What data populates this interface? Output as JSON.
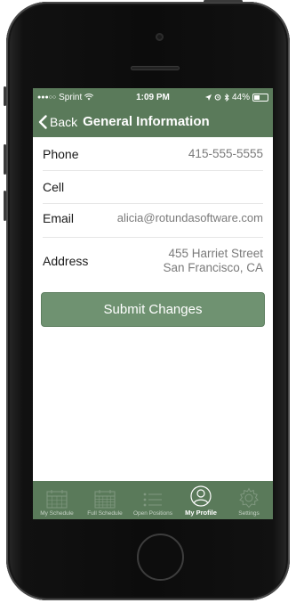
{
  "status_bar": {
    "carrier": "Sprint",
    "time": "1:09 PM",
    "battery_percent": "44%",
    "battery_level": 0.44
  },
  "nav": {
    "back_label": "Back",
    "title": "General Information"
  },
  "fields": [
    {
      "label": "Phone",
      "value": "415-555-5555"
    },
    {
      "label": "Cell",
      "value": ""
    },
    {
      "label": "Email",
      "value": "alicia@rotundasoftware.com"
    },
    {
      "label": "Address",
      "value": "455 Harriet Street San Francisco, CA"
    }
  ],
  "submit_label": "Submit Changes",
  "tabs": [
    {
      "label": "My Schedule",
      "icon": "calendar-icon",
      "active": false
    },
    {
      "label": "Full Schedule",
      "icon": "calendar-grid-icon",
      "active": false
    },
    {
      "label": "Open Positions",
      "icon": "list-icon",
      "active": false
    },
    {
      "label": "My Profile",
      "icon": "profile-icon",
      "active": true
    },
    {
      "label": "Settings",
      "icon": "gear-icon",
      "active": false
    }
  ],
  "colors": {
    "brand_green": "#5a7a5a",
    "button_green": "#6f9271"
  }
}
